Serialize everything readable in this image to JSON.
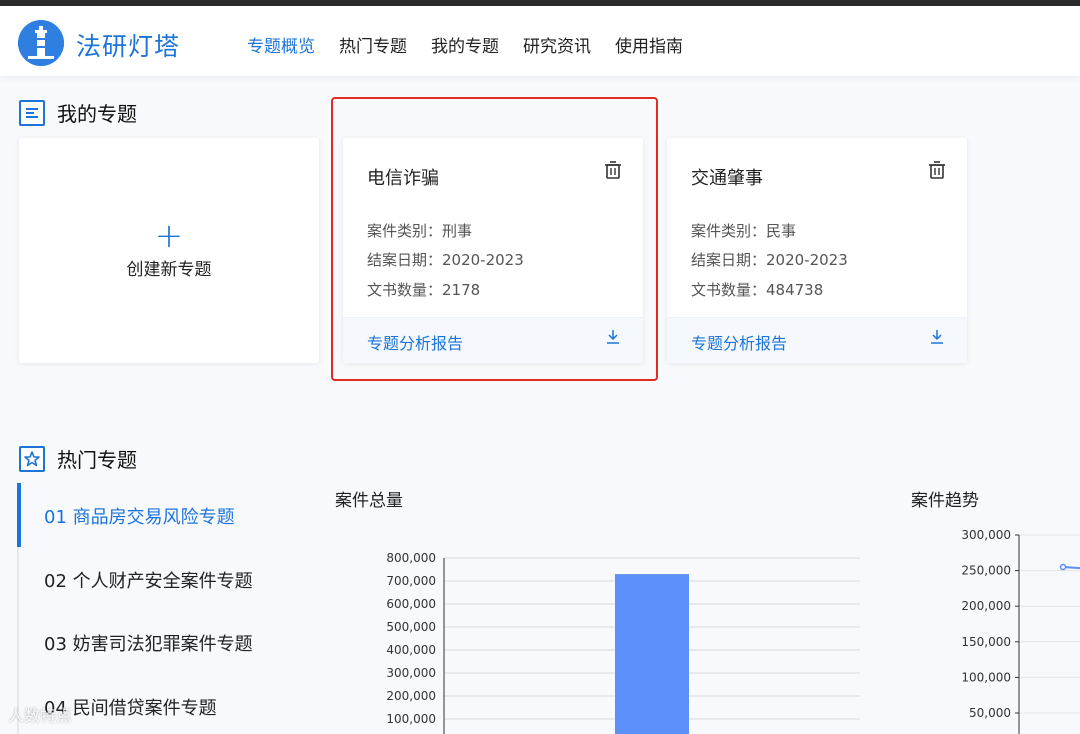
{
  "app": {
    "brand": "法研灯塔",
    "nav": [
      "专题概览",
      "热门专题",
      "我的专题",
      "研究资讯",
      "使用指南"
    ],
    "active_nav": 0
  },
  "my_topics": {
    "section_title": "我的专题",
    "create_label": "创建新专题",
    "cards": [
      {
        "title": "电信诈骗",
        "category": "案件类别：刑事",
        "date": "结案日期：2020-2023",
        "count": "文书数量：2178",
        "report": "专题分析报告",
        "highlighted": true
      },
      {
        "title": "交通肇事",
        "category": "案件类别：民事",
        "date": "结案日期：2020-2023",
        "count": "文书数量：484738",
        "report": "专题分析报告",
        "highlighted": false
      }
    ]
  },
  "hot_topics": {
    "section_title": "热门专题",
    "items": [
      "01 商品房交易风险专题",
      "02 个人财产安全案件专题",
      "03 妨害司法犯罪案件专题",
      "04 民间借贷案件专题"
    ],
    "active_item": 0
  },
  "chart_data": [
    {
      "type": "bar",
      "title": "案件总量",
      "y_ticks": [
        "100,000",
        "200,000",
        "300,000",
        "400,000",
        "500,000",
        "600,000",
        "700,000",
        "800,000"
      ],
      "ylim": [
        0,
        800000
      ],
      "values": [
        730000
      ],
      "grid": true,
      "color": "#5b8ff9"
    },
    {
      "type": "line",
      "title": "案件趋势",
      "y_ticks": [
        "50,000",
        "100,000",
        "150,000",
        "200,000",
        "250,000",
        "300,000"
      ],
      "ylim": [
        0,
        300000
      ],
      "values": [
        255000,
        252000
      ],
      "color": "#5b8ff9"
    }
  ],
  "watermark": "人数特点"
}
